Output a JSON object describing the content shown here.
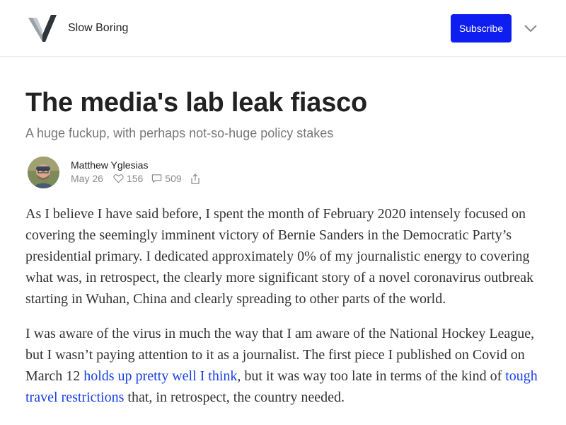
{
  "header": {
    "publication": "Slow Boring",
    "subscribe_label": "Subscribe",
    "accent_color": "#0f1ef0"
  },
  "post": {
    "title": "The media's lab leak fiasco",
    "subtitle": "A huge fuckup, with perhaps not-so-huge policy stakes",
    "author": "Matthew Yglesias",
    "date": "May 26",
    "likes": "156",
    "comments": "509"
  },
  "body": {
    "p1": "As I believe I have said before, I spent the month of February 2020 intensely focused on covering the seemingly imminent victory of Bernie Sanders in the Democratic Party’s presidential primary. I dedicated approximately 0% of my journalistic energy to covering what was, in retrospect, the clearly more significant story of a novel coronavirus outbreak starting in Wuhan, China and clearly spreading to other parts of the world.",
    "p2_a": "I was aware of the virus in much the way that I am aware of the National Hockey League, but I wasn’t paying attention to it as a journalist. The first piece I published on Covid on March 12 ",
    "p2_link1": "holds up pretty well I think",
    "p2_b": ", but it was way too late in terms of the kind of ",
    "p2_link2": "tough travel restrictions",
    "p2_c": " that, in retrospect, the country needed."
  },
  "icons": {
    "logo": "slow-boring-logo",
    "dropdown": "chevron-down-icon",
    "like": "heart-icon",
    "comment": "comment-icon",
    "share": "share-icon"
  }
}
